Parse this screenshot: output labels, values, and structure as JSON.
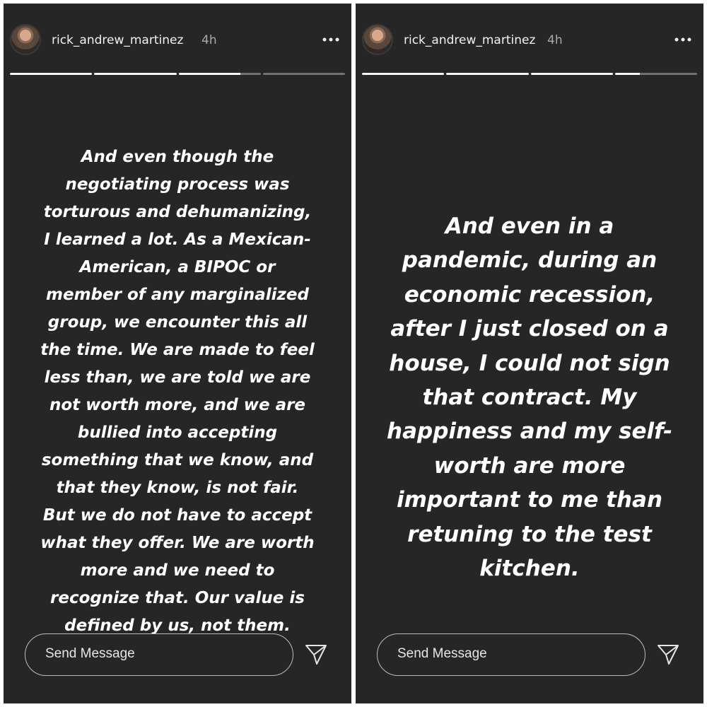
{
  "stories": [
    {
      "username": "rick_andrew_martinez",
      "time": "4h",
      "progress": [
        1,
        1,
        0.75,
        0
      ],
      "text": "And even though the negotiating process was torturous and dehumanizing, I learned a lot. As a Mexican-American, a BIPOC or member of any marginalized group, we encounter this all the time. We are made to feel less than, we are told we are not worth more, and we are bullied into accepting something that we know, and that they know, is not fair. But we do not have to accept what they offer. We are worth more and we need to recognize that. Our value is defined by us, not them.",
      "lines": [
        "And even though the",
        "negotiating process was",
        "torturous and dehumanizing,",
        "I learned a lot. As a Mexican-",
        "American, a BIPOC or",
        "member of any marginalized",
        "group, we encounter this all",
        "the time. We are made to feel",
        "less than, we are told we are",
        "not worth more, and we are",
        "bullied into accepting",
        "something that we know, and",
        "that they know, is not fair.",
        "But we do not have to accept",
        "what they offer. We are worth",
        "more and we need to",
        "recognize that. Our value is",
        "defined by us, not them."
      ],
      "message_placeholder": "Send Message",
      "icons": {
        "more": "more-options-icon",
        "send": "send-icon"
      }
    },
    {
      "username": "rick_andrew_martinez",
      "time": "4h",
      "progress": [
        1,
        1,
        1,
        0.3
      ],
      "text": "And even in a pandemic, during an economic recession, after I just closed on a house, I could not sign that contract. My happiness and my self-worth are more important to me than retuning to the test kitchen.",
      "lines": [
        "And even in a",
        "pandemic, during an",
        "economic recession,",
        "after I just closed on a",
        "house, I could not sign",
        "that contract. My",
        "happiness and my self-",
        "worth are more",
        "important to me than",
        "retuning to the test",
        "kitchen."
      ],
      "message_placeholder": "Send Message",
      "icons": {
        "more": "more-options-icon",
        "send": "send-icon"
      }
    }
  ],
  "colors": {
    "background": "#262626",
    "text": "#ffffff",
    "muted": "#a8a8a8",
    "border": "#bdbdbd"
  }
}
